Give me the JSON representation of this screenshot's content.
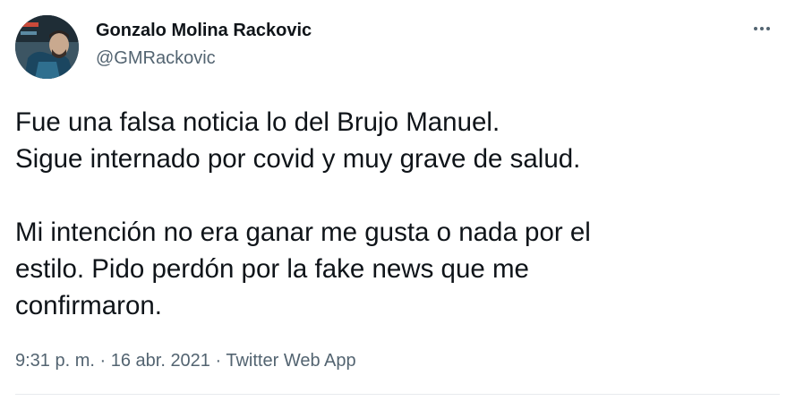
{
  "author": {
    "name": "Gonzalo Molina Rackovic",
    "handle": "@GMRackovic"
  },
  "tweet": {
    "lines": [
      "Fue una falsa noticia lo del Brujo Manuel.",
      "Sigue internado por covid y muy grave de salud."
    ],
    "lines2": [
      "Mi intención no era ganar me gusta o nada por el",
      "estilo. Pido perdón por la fake news que me",
      "confirmaron."
    ]
  },
  "meta": {
    "time": "9:31 p. m.",
    "separator": " · ",
    "date": "16 abr. 2021",
    "app": "Twitter Web App"
  },
  "icons": {
    "more": "more-horizontal-icon"
  }
}
